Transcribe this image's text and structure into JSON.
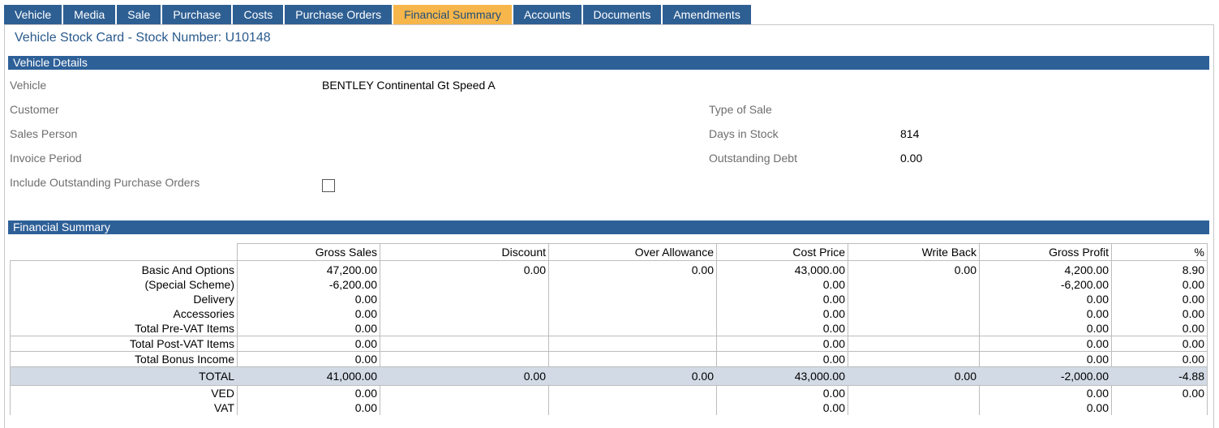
{
  "tabs": [
    {
      "label": "Vehicle"
    },
    {
      "label": "Media"
    },
    {
      "label": "Sale"
    },
    {
      "label": "Purchase"
    },
    {
      "label": "Costs"
    },
    {
      "label": "Purchase Orders"
    },
    {
      "label": "Financial Summary"
    },
    {
      "label": "Accounts"
    },
    {
      "label": "Documents"
    },
    {
      "label": "Amendments"
    }
  ],
  "active_tab": "Financial Summary",
  "page_title": "Vehicle Stock Card - Stock Number: U10148",
  "vehicle_details": {
    "header": "Vehicle Details",
    "vehicle_label": "Vehicle",
    "vehicle_value": "BENTLEY Continental Gt Speed A",
    "customer_label": "Customer",
    "sales_person_label": "Sales Person",
    "invoice_period_label": "Invoice Period",
    "include_po_label": "Include Outstanding Purchase Orders",
    "include_po_checked": false,
    "type_of_sale_label": "Type of Sale",
    "days_in_stock_label": "Days in Stock",
    "days_in_stock_value": "814",
    "outstanding_debt_label": "Outstanding Debt",
    "outstanding_debt_value": "0.00"
  },
  "financial_summary": {
    "header": "Financial Summary",
    "columns": [
      "Gross Sales",
      "Discount",
      "Over Allowance",
      "Cost Price",
      "Write Back",
      "Gross Profit",
      "%"
    ],
    "rows": [
      {
        "label": "Basic And Options",
        "cells": [
          "47,200.00",
          "0.00",
          "0.00",
          "43,000.00",
          "0.00",
          "4,200.00",
          "8.90"
        ]
      },
      {
        "label": "(Special Scheme)",
        "cells": [
          "-6,200.00",
          "",
          "",
          "0.00",
          "",
          "-6,200.00",
          "0.00"
        ]
      },
      {
        "label": "Delivery",
        "cells": [
          "0.00",
          "",
          "",
          "0.00",
          "",
          "0.00",
          "0.00"
        ]
      },
      {
        "label": "Accessories",
        "cells": [
          "0.00",
          "",
          "",
          "0.00",
          "",
          "0.00",
          "0.00"
        ]
      },
      {
        "label": "Total Pre-VAT Items",
        "cells": [
          "0.00",
          "",
          "",
          "0.00",
          "",
          "0.00",
          "0.00"
        ]
      },
      {
        "label": "Total Post-VAT Items",
        "cells": [
          "0.00",
          "",
          "",
          "0.00",
          "",
          "0.00",
          "0.00"
        ]
      },
      {
        "label": "Total Bonus Income",
        "cells": [
          "0.00",
          "",
          "",
          "0.00",
          "",
          "0.00",
          "0.00"
        ]
      },
      {
        "label": "TOTAL",
        "cells": [
          "41,000.00",
          "0.00",
          "0.00",
          "43,000.00",
          "0.00",
          "-2,000.00",
          "-4.88"
        ]
      },
      {
        "label": "VED",
        "cells": [
          "0.00",
          "",
          "",
          "0.00",
          "",
          "0.00",
          "0.00"
        ]
      },
      {
        "label": "VAT",
        "cells": [
          "0.00",
          "",
          "",
          "0.00",
          "",
          "0.00",
          ""
        ]
      }
    ]
  },
  "colors": {
    "tab_bg": "#2e5f93",
    "tab_active_bg": "#f6b64b",
    "section_bar": "#2e6098",
    "title_text": "#2a5a8c",
    "total_row_bg": "#d2dae5"
  }
}
